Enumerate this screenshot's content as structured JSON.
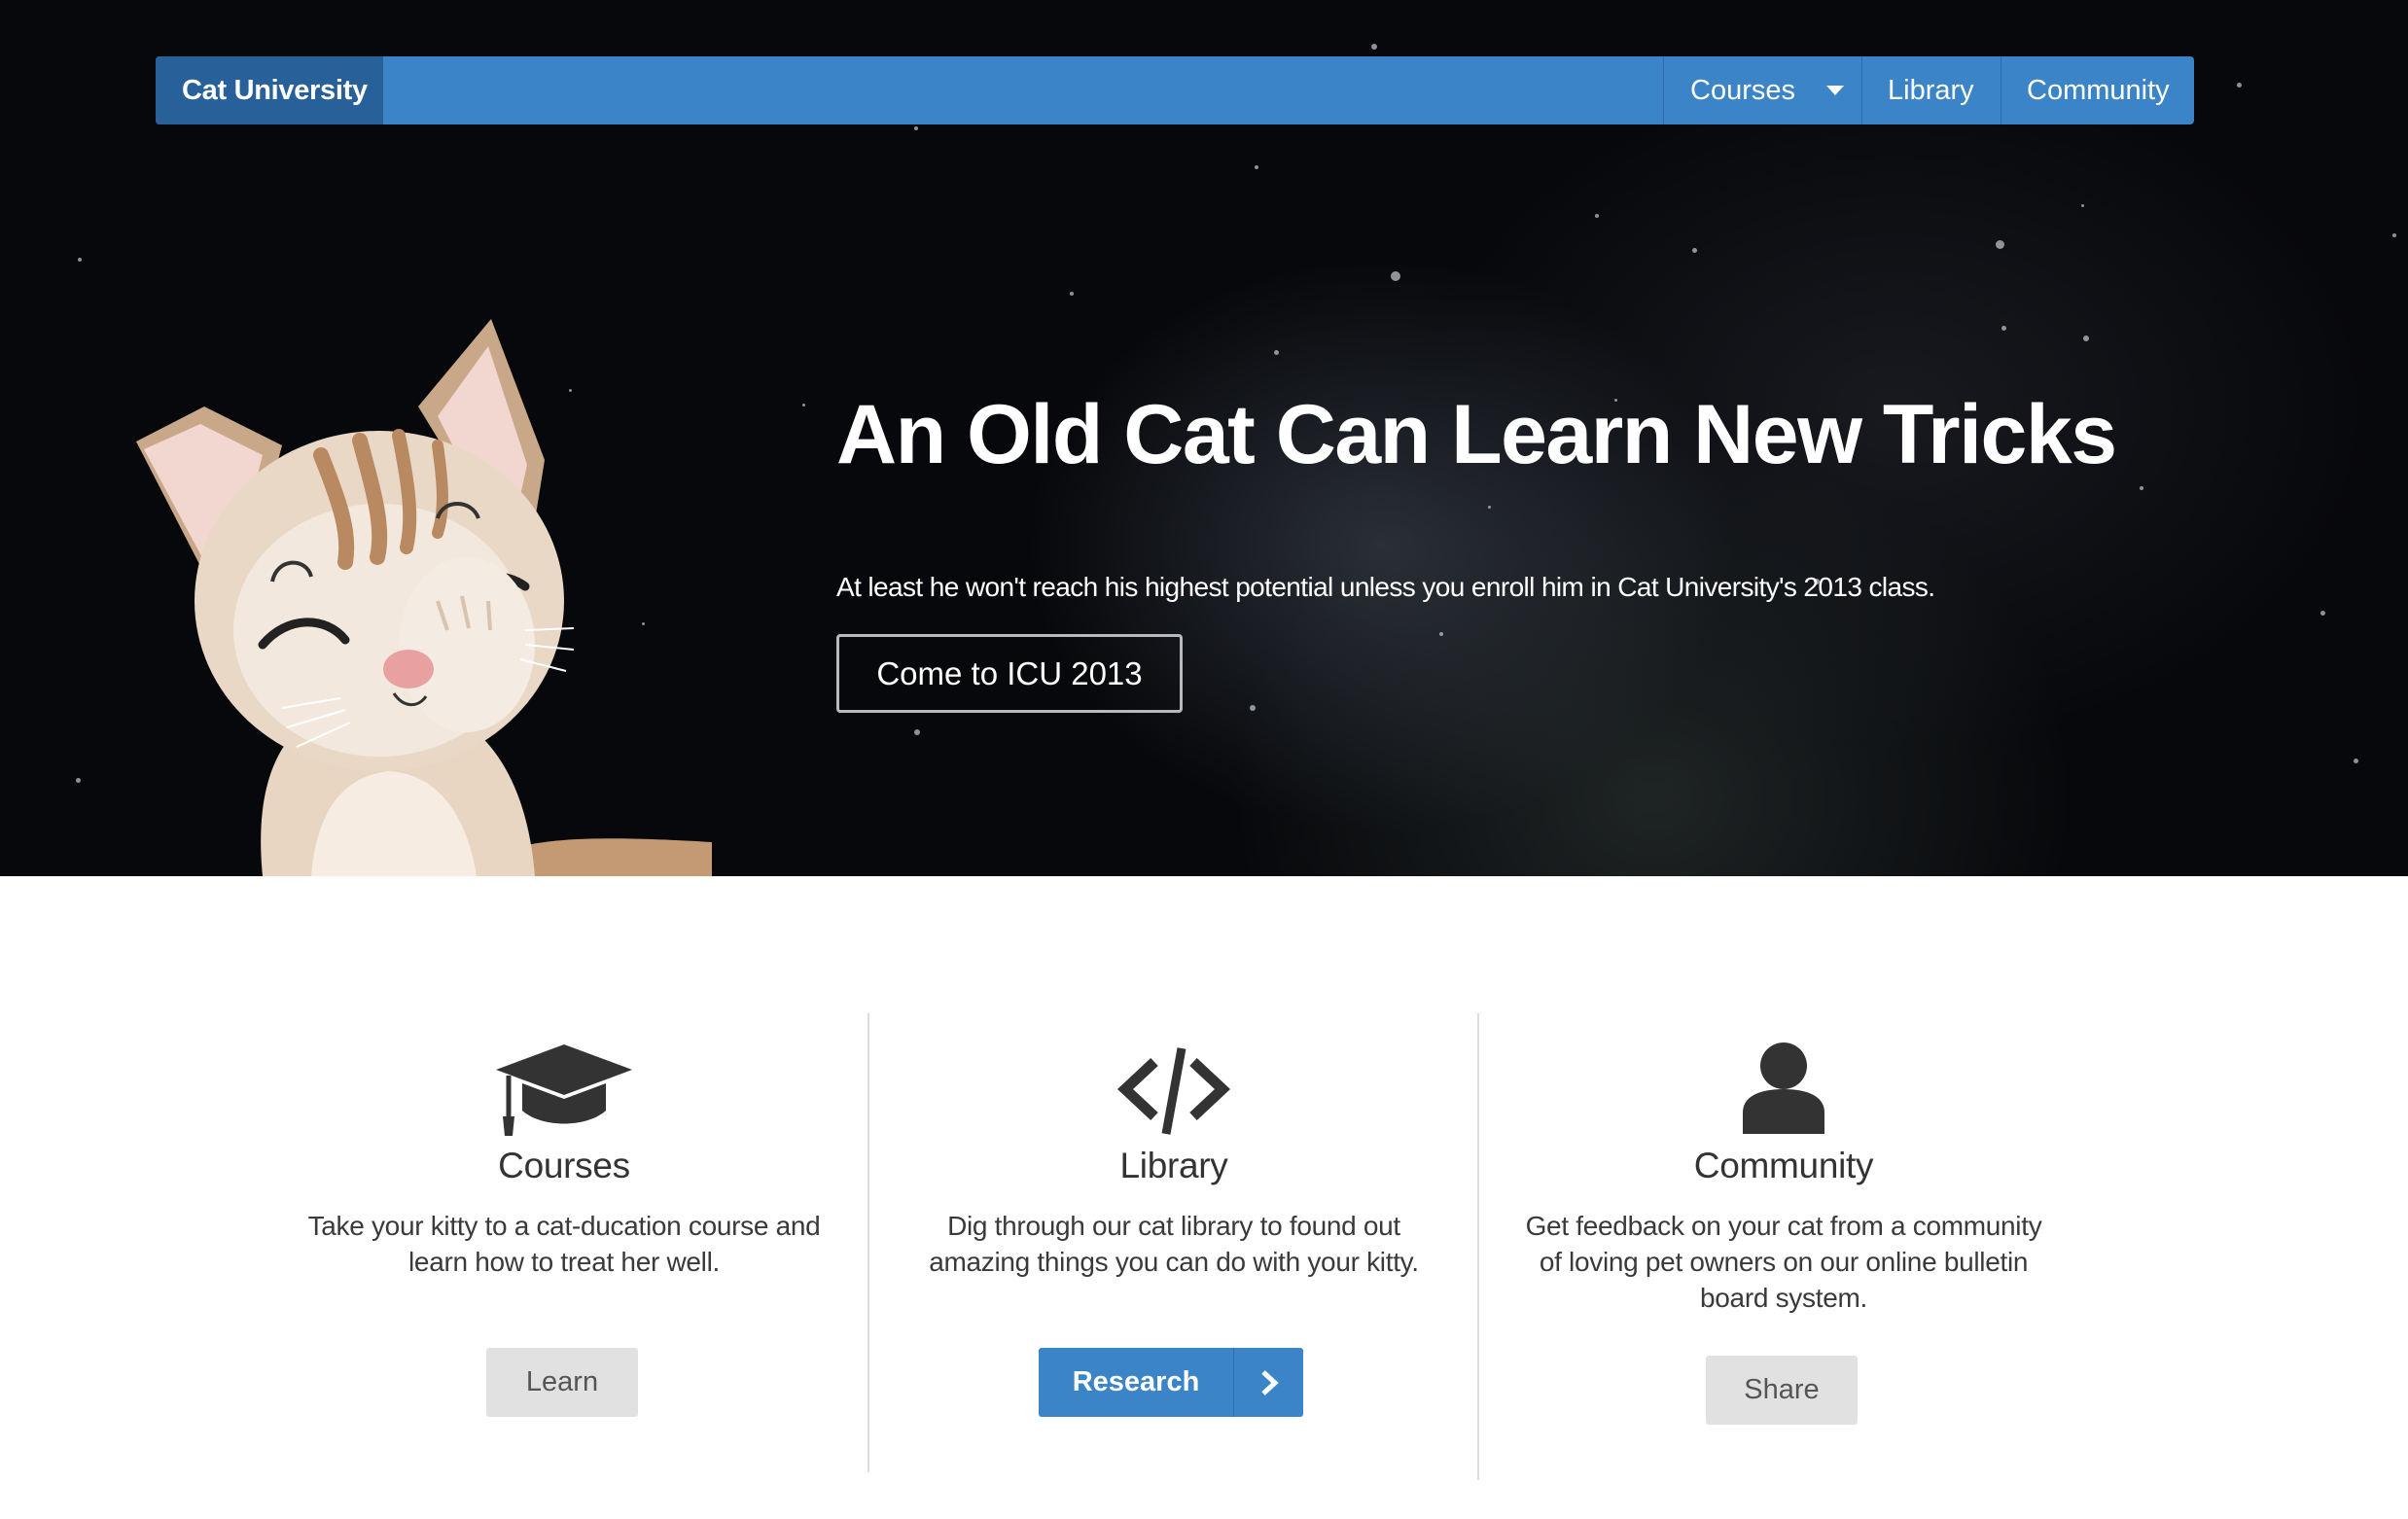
{
  "navbar": {
    "brand": "Cat University",
    "items": [
      {
        "label": "Courses",
        "has_dropdown": true
      },
      {
        "label": "Library"
      },
      {
        "label": "Community"
      }
    ]
  },
  "hero": {
    "title": "An Old Cat Can Learn New Tricks",
    "subtitle": "At least he won't reach his highest potential unless you enroll him in Cat University's 2013 class.",
    "cta_label": "Come to ICU 2013"
  },
  "features": [
    {
      "icon": "graduation-cap-icon",
      "title": "Courses",
      "text": "Take your kitty to a cat-ducation course and learn how to treat her well.",
      "button": "Learn"
    },
    {
      "icon": "code-icon",
      "title": "Library",
      "text": "Dig through our cat library to found out amazing things you can do with your kitty.",
      "button": "Research"
    },
    {
      "icon": "user-icon",
      "title": "Community",
      "text": "Get feedback on your cat from a community of loving pet owners on our online bulletin board system.",
      "button": "Share"
    }
  ],
  "colors": {
    "nav_blue": "#3a84c7",
    "brand_blue": "#28609a",
    "hero_bg": "#07080b",
    "gray_button": "#e1e1e1"
  }
}
